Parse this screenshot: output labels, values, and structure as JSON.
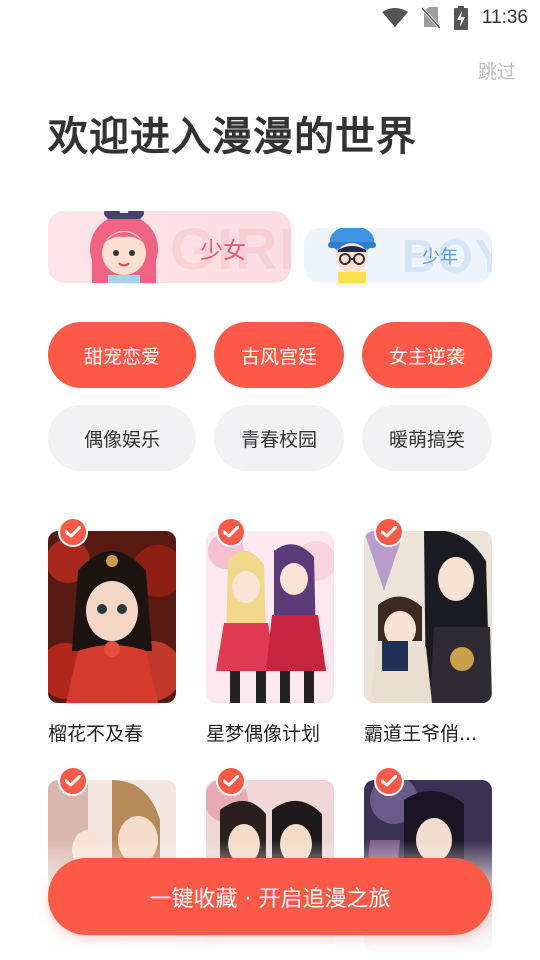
{
  "status_bar": {
    "time": "11:36",
    "icons": [
      "wifi-icon",
      "no-sim-icon",
      "battery-charging-icon"
    ]
  },
  "header": {
    "skip_label": "跳过",
    "title": "欢迎进入漫漫的世界"
  },
  "gender": {
    "girl": {
      "label": "少女",
      "watermark": "GIRL"
    },
    "boy": {
      "label": "少年",
      "watermark": "BOY"
    }
  },
  "tags": [
    {
      "label": "甜宠恋爱",
      "selected": true
    },
    {
      "label": "古风宫廷",
      "selected": true
    },
    {
      "label": "女主逆袭",
      "selected": true
    },
    {
      "label": "偶像娱乐",
      "selected": false
    },
    {
      "label": "青春校园",
      "selected": false
    },
    {
      "label": "暖萌搞笑",
      "selected": false
    }
  ],
  "books": [
    {
      "title": "榴花不及春",
      "checked": true
    },
    {
      "title": "星梦偶像计划",
      "checked": true
    },
    {
      "title": "霸道王爷俏...",
      "checked": true
    },
    {
      "title": "",
      "checked": true
    },
    {
      "title": "",
      "checked": true
    },
    {
      "title": "",
      "checked": true
    }
  ],
  "cta": {
    "label": "一键收藏 · 开启追漫之旅"
  },
  "colors": {
    "accent": "#fa5a47",
    "girl": "#ef5a73",
    "boy": "#5a9be0",
    "muted": "#bdbdbd"
  }
}
